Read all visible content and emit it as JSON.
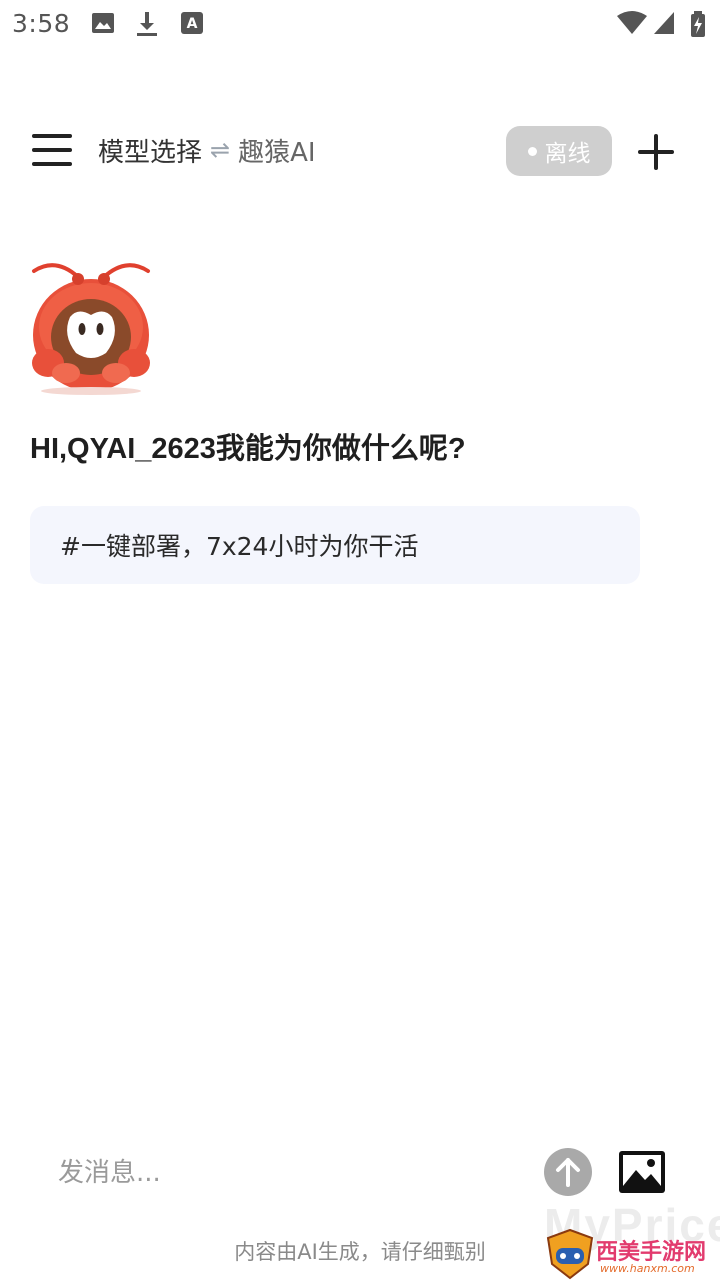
{
  "status_bar": {
    "time": "3:58",
    "icons": [
      "image-icon",
      "download-icon",
      "a-icon",
      "wifi-icon",
      "signal-icon",
      "battery-charging-icon"
    ]
  },
  "header": {
    "model_select_label": "模型选择",
    "switch_glyph": "⇌",
    "current_model": "趣猿AI",
    "status": "离线",
    "status_color": "#cfcfcf"
  },
  "greeting": "HI,QYAI_2623我能为你做什么呢?",
  "suggestion": "#一键部署，7x24小时为你干活",
  "input": {
    "placeholder": "发消息..."
  },
  "disclaimer": "内容由AI生成，请仔细甄别",
  "watermark": {
    "ghost": "MyPrice",
    "site_name": "西美手游网",
    "url": "www.hanxm.com"
  }
}
